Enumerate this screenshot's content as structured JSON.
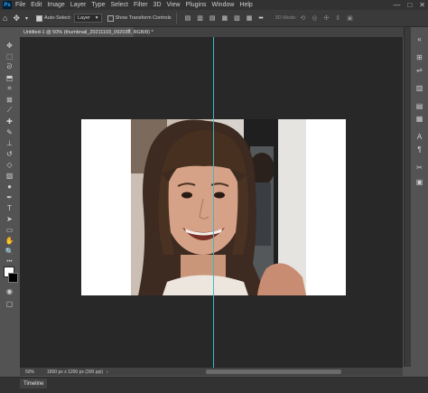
{
  "app": {
    "logo_text": "Ps"
  },
  "menu": [
    "File",
    "Edit",
    "Image",
    "Layer",
    "Type",
    "Select",
    "Filter",
    "3D",
    "View",
    "Plugins",
    "Window",
    "Help"
  ],
  "window_controls": {
    "minimize": "—",
    "maximize": "□",
    "close": "✕"
  },
  "options_bar": {
    "auto_select_label": "Auto-Select:",
    "auto_select_value": "Layer",
    "show_transform_label": "Show Transform Controls",
    "mode_label": "3D Mode:"
  },
  "document_tab": {
    "title": "Untitled-1 @ 50% (thumbnail_20211103_092038, RGB/8) *",
    "close": "×"
  },
  "status": {
    "zoom": "50%",
    "doc_info": "1800 px x 1200 px (300 ppi)",
    "caret": "›"
  },
  "timeline": {
    "label": "Timeline"
  },
  "colors": {
    "foreground": "#ffffff",
    "background": "#000000",
    "guide": "#3fb7c4",
    "canvas_bg": "#282828"
  }
}
